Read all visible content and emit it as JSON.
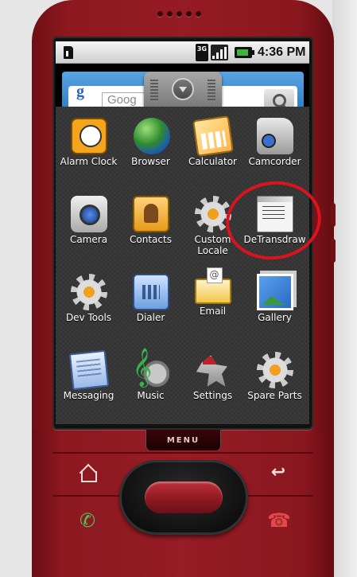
{
  "status_bar": {
    "network_type": "3G",
    "time": "4:36 PM"
  },
  "search": {
    "placeholder": "Goog"
  },
  "apps": [
    {
      "label": "Alarm Clock",
      "icon": "alarm-clock-icon"
    },
    {
      "label": "Browser",
      "icon": "browser-globe-icon"
    },
    {
      "label": "Calculator",
      "icon": "calculator-icon"
    },
    {
      "label": "Camcorder",
      "icon": "camcorder-icon"
    },
    {
      "label": "Camera",
      "icon": "camera-icon"
    },
    {
      "label": "Contacts",
      "icon": "contacts-icon"
    },
    {
      "label": "Custom Locale",
      "icon": "gear-icon"
    },
    {
      "label": "DeTransdraw",
      "icon": "window-icon"
    },
    {
      "label": "Dev Tools",
      "icon": "gear-icon"
    },
    {
      "label": "Dialer",
      "icon": "dialer-icon"
    },
    {
      "label": "Email",
      "icon": "email-icon"
    },
    {
      "label": "Gallery",
      "icon": "gallery-icon"
    },
    {
      "label": "Messaging",
      "icon": "messaging-icon"
    },
    {
      "label": "Music",
      "icon": "music-icon"
    },
    {
      "label": "Settings",
      "icon": "settings-tools-icon"
    },
    {
      "label": "Spare Parts",
      "icon": "gear-icon"
    }
  ],
  "hardware": {
    "menu_label": "MENU"
  },
  "colors": {
    "phone_body": "#951b24",
    "annotation": "#d9141e",
    "drawer_bg": "#3a3a3a"
  }
}
